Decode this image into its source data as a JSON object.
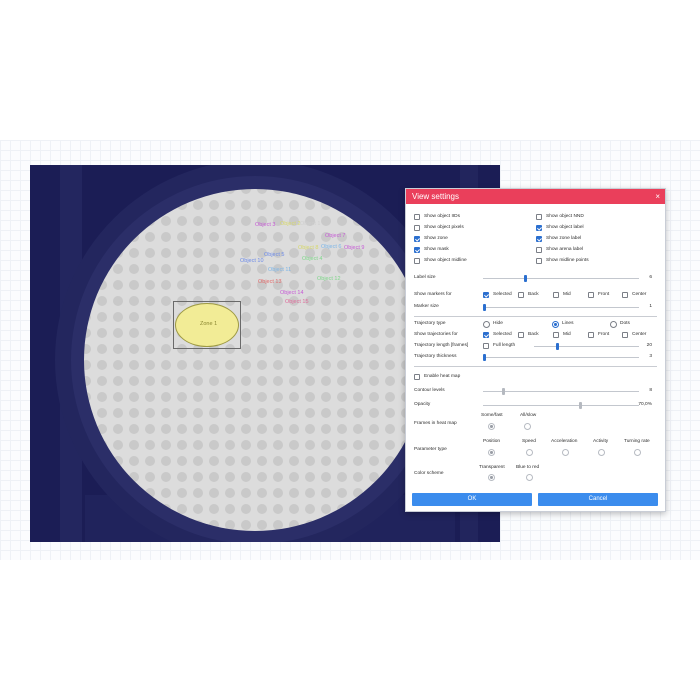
{
  "colors": {
    "title_bar": "#ea3f5b",
    "accent": "#2b6fcf",
    "button": "#3b8ced",
    "zone_fill": "#f5f0a4"
  },
  "arena": {
    "zone_label": "Zone 1",
    "objects": [
      {
        "label": "Object 3",
        "color": "#c65ad6"
      },
      {
        "label": "Object 2",
        "color": "#d6d86a"
      },
      {
        "label": "Object 1",
        "color": "#e0e0e0"
      },
      {
        "label": "Object 7",
        "color": "#c65ad6"
      },
      {
        "label": "Object 5",
        "color": "#6c8ae8"
      },
      {
        "label": "Object 8",
        "color": "#d6d86a"
      },
      {
        "label": "Object 6",
        "color": "#7db6e8"
      },
      {
        "label": "Object 9",
        "color": "#c65ad6"
      },
      {
        "label": "Object 4",
        "color": "#7fd68a"
      },
      {
        "label": "Object 10",
        "color": "#6c8ae8"
      },
      {
        "label": "Object 11",
        "color": "#7db6e8"
      },
      {
        "label": "Object 12",
        "color": "#7fd68a"
      },
      {
        "label": "Object 13",
        "color": "#e06a6a"
      },
      {
        "label": "Object 14",
        "color": "#c65ad6"
      },
      {
        "label": "Object 15",
        "color": "#e06a9a"
      }
    ]
  },
  "dialog": {
    "title": "View settings",
    "close_icon": "×",
    "show": {
      "object_ids": {
        "label": "Show object IIDs",
        "checked": false
      },
      "object_nnd": {
        "label": "Show object NND",
        "checked": false
      },
      "object_pixels": {
        "label": "Show object pixels",
        "checked": false
      },
      "object_label": {
        "label": "Show object label",
        "checked": true
      },
      "zone": {
        "label": "Show zone",
        "checked": true
      },
      "zone_label": {
        "label": "Show zone label",
        "checked": true
      },
      "mask": {
        "label": "Show mask",
        "checked": true
      },
      "arena_label": {
        "label": "Show arena label",
        "checked": false
      },
      "object_midline": {
        "label": "Show object midline",
        "checked": false
      },
      "midline_points": {
        "label": "Show midline points",
        "checked": false
      }
    },
    "label_size": {
      "label": "Label size",
      "value": "6",
      "fraction": 0.27
    },
    "markers_for": {
      "label": "Show markers for",
      "options": [
        "Selected",
        "Back",
        "Mid",
        "Front",
        "Center"
      ],
      "checked": [
        true,
        false,
        false,
        false,
        false
      ]
    },
    "marker_size": {
      "label": "Marker size",
      "value": "1",
      "fraction": 0.0
    },
    "trajectory_type": {
      "label": "Trajectory type",
      "options": [
        "Hide",
        "Lines",
        "Dots"
      ],
      "selected": 1
    },
    "trajectories_for": {
      "label": "Show trajectories for",
      "options": [
        "Selected",
        "Back",
        "Mid",
        "Front",
        "Center"
      ],
      "checked": [
        true,
        false,
        false,
        false,
        false
      ]
    },
    "trajectory_length": {
      "label": "Trajectory length [frames]",
      "full_length_label": "Full length",
      "full_length_checked": false,
      "value": "20",
      "fraction": 0.25
    },
    "trajectory_thickness": {
      "label": "Trajectory thickness",
      "value": "3",
      "fraction": 0.0
    },
    "heat_map": {
      "label": "Enable heat map",
      "checked": false
    },
    "contour_levels": {
      "label": "Contour levels",
      "value": "8",
      "fraction": 0.18
    },
    "opacity": {
      "label": "Opacity",
      "value": "70,0%",
      "fraction": 0.7
    },
    "frames_in_heat_map": {
      "label": "Frames in heat map",
      "options": [
        "Some/fast",
        "All/slow"
      ],
      "selected": 0
    },
    "parameter_type": {
      "label": "Parameter type",
      "options": [
        "Position",
        "Speed",
        "Acceleration",
        "Activity",
        "Turning rate"
      ],
      "selected": 0
    },
    "color_scheme": {
      "label": "Color scheme",
      "options": [
        "Transparent",
        "Blue to red"
      ],
      "selected": 0
    },
    "ok_label": "OK",
    "cancel_label": "Cancel"
  }
}
